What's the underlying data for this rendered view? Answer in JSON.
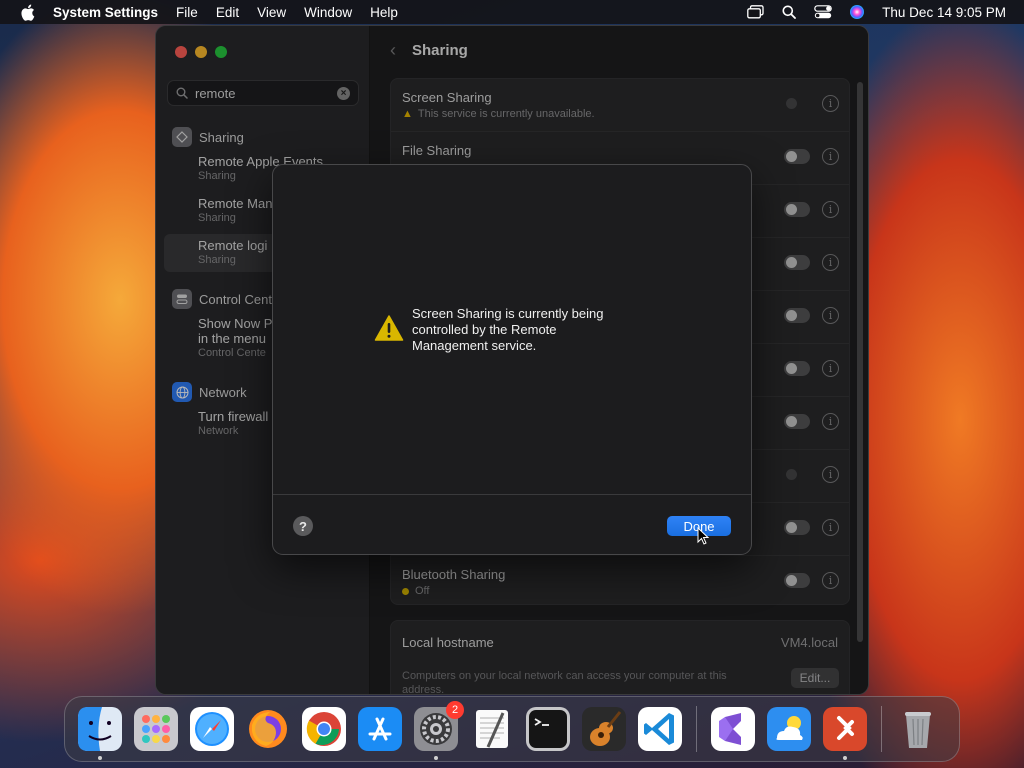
{
  "menubar": {
    "app_name": "System Settings",
    "menus": [
      "File",
      "Edit",
      "View",
      "Window",
      "Help"
    ],
    "clock": "Thu Dec 14  9:05 PM"
  },
  "sidebar": {
    "search_value": "remote",
    "sections": [
      {
        "label": "Sharing",
        "icon": "sharing-icon",
        "color": "#8e8e93",
        "items": [
          {
            "title": "Remote Apple Events",
            "category": "Sharing"
          },
          {
            "title": "Remote Man",
            "category": "Sharing"
          },
          {
            "title": "Remote logi",
            "category": "Sharing",
            "selected": true
          }
        ]
      },
      {
        "label": "Control Cent",
        "icon": "control-center-icon",
        "color": "#8e8e93",
        "items": [
          {
            "title": "Show Now P",
            "title2": "in the menu",
            "category": "Control Cente"
          }
        ]
      },
      {
        "label": "Network",
        "icon": "network-globe-icon",
        "color": "#2f7cf6",
        "items": [
          {
            "title": "Turn firewall",
            "category": "Network"
          }
        ]
      }
    ]
  },
  "content": {
    "title": "Sharing",
    "services": [
      {
        "name": "Screen Sharing",
        "status": "This service is currently unavailable.",
        "status_kind": "warning",
        "toggle": "disabled"
      },
      {
        "name": "File Sharing",
        "status": "",
        "toggle": "off"
      },
      {
        "name": "",
        "status": "",
        "toggle": "off"
      },
      {
        "name": "",
        "status": "",
        "toggle": "off"
      },
      {
        "name": "",
        "status": "",
        "toggle": "off"
      },
      {
        "name": "",
        "status": "",
        "toggle": "off"
      },
      {
        "name": "",
        "status": "",
        "toggle": "off"
      },
      {
        "name": "",
        "status": "",
        "toggle": "disabled"
      },
      {
        "name": "",
        "status": "",
        "toggle": "off"
      },
      {
        "name": "Bluetooth Sharing",
        "status": "Off",
        "status_kind": "dot",
        "status_color": "#d9b700",
        "toggle": "off"
      }
    ],
    "hostname": {
      "label": "Local hostname",
      "value": "VM4.local",
      "description": "Computers on your local network can access your computer at this address.",
      "edit_label": "Edit..."
    }
  },
  "sheet": {
    "message": "Screen Sharing is currently being controlled by the Remote Management service.",
    "help_label": "?",
    "done_label": "Done"
  },
  "dock": {
    "apps": [
      {
        "name": "finder-icon",
        "running": true
      },
      {
        "name": "launchpad-icon",
        "running": false
      },
      {
        "name": "safari-icon",
        "running": false
      },
      {
        "name": "firefox-icon",
        "running": false
      },
      {
        "name": "chrome-icon",
        "running": false
      },
      {
        "name": "app-store-icon",
        "running": false
      },
      {
        "name": "system-settings-icon",
        "running": true,
        "badge": "2"
      },
      {
        "name": "textedit-icon",
        "running": false
      },
      {
        "name": "terminal-icon",
        "running": false
      },
      {
        "name": "garageband-icon",
        "running": false
      },
      {
        "name": "vscode-icon",
        "running": false
      },
      {
        "name": "visual-studio-icon",
        "running": false
      },
      {
        "name": "weather-icon",
        "running": false
      },
      {
        "name": "remote-desktop-icon",
        "running": true
      },
      {
        "name": "trash-icon",
        "running": false
      }
    ]
  }
}
